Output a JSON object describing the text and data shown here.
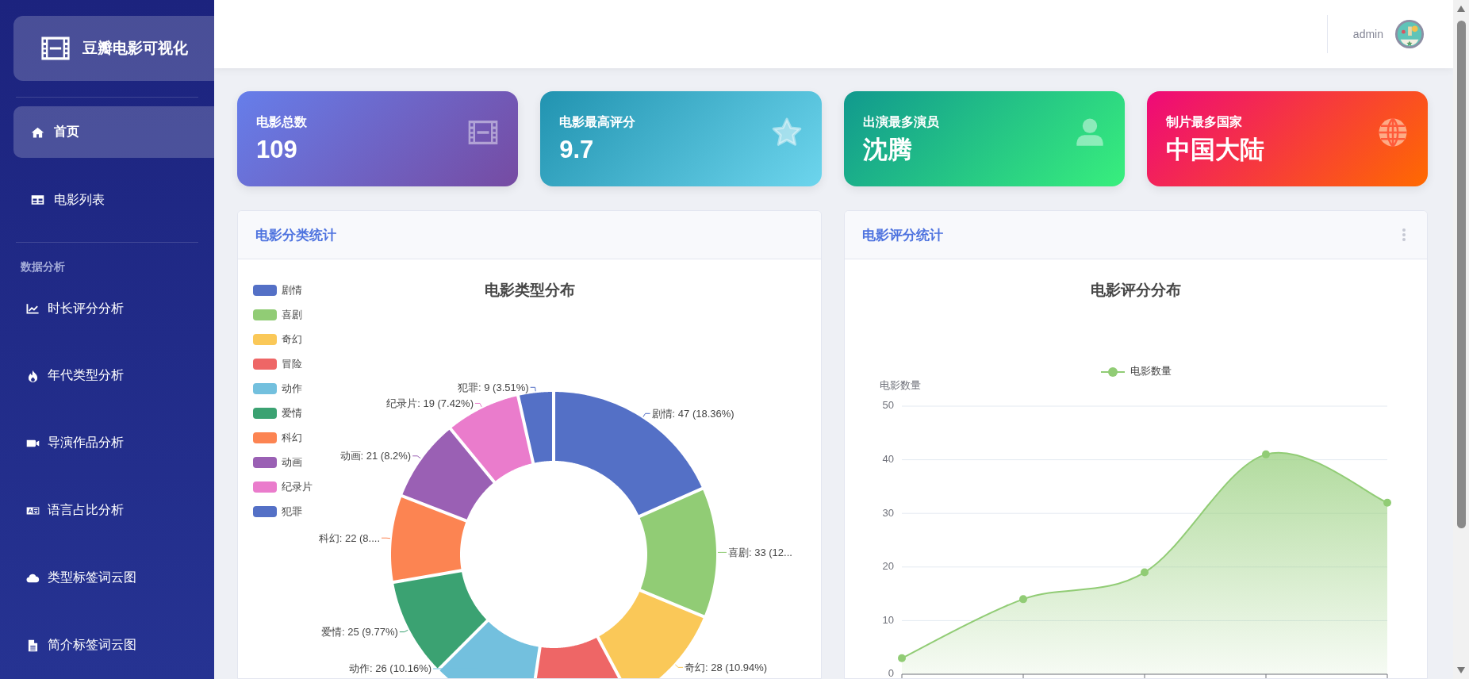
{
  "sidebar": {
    "brand": "豆瓣电影可视化",
    "items": [
      {
        "label": "首页",
        "selected": true
      },
      {
        "label": "电影列表",
        "selected": false
      }
    ],
    "section_title": "数据分析",
    "analysis_items": [
      {
        "label": "时长评分分析",
        "selected": false
      },
      {
        "label": "年代类型分析",
        "selected": false
      },
      {
        "label": "导演作品分析",
        "selected": false
      },
      {
        "label": "语言占比分析",
        "selected": false
      },
      {
        "label": "类型标签词云图",
        "selected": false
      },
      {
        "label": "简介标签词云图",
        "selected": false
      }
    ]
  },
  "header": {
    "user": "admin"
  },
  "stat_cards": [
    {
      "label": "电影总数",
      "value": "109"
    },
    {
      "label": "电影最高评分",
      "value": "9.7"
    },
    {
      "label": "出演最多演员",
      "value": "沈腾"
    },
    {
      "label": "制片最多国家",
      "value": "中国大陆"
    }
  ],
  "panels": [
    {
      "title": "电影分类统计",
      "has_menu": false,
      "chart_data": {
        "type": "donut",
        "title": "电影类型分布",
        "legend": "top-left",
        "categories": [
          "剧情",
          "喜剧",
          "奇幻",
          "冒险",
          "动作",
          "爱情",
          "科幻",
          "动画",
          "纪录片",
          "犯罪"
        ],
        "values": [
          47,
          33,
          28,
          26,
          26,
          25,
          22,
          21,
          19,
          9
        ],
        "colors": [
          "#5470c6",
          "#91cc75",
          "#fac858",
          "#ee6666",
          "#73c0de",
          "#3ba272",
          "#fc8452",
          "#9a60b4",
          "#ea7ccc",
          "#5470c6"
        ],
        "value_labels": [
          "剧情: 47 (18.36%)",
          "喜剧: 33 (12...",
          "奇幻: 28 (10.94%)",
          null,
          "动作: 26 (10.16%)",
          "爱情: 25 (9.77%)",
          "科幻: 22 (8....",
          "动画: 21 (8.2%)",
          "纪录片: 19 (7.42%)",
          "犯罪: 9 (3.51%)"
        ]
      }
    },
    {
      "title": "电影评分统计",
      "has_menu": true,
      "chart_data": {
        "type": "area",
        "title": "电影评分分布",
        "ylabel": "电影数量",
        "legend": "top",
        "grid": true,
        "series": [
          {
            "name": "电影数量",
            "color": "#91cc75",
            "values": [
              3,
              14,
              19,
              41,
              32
            ]
          }
        ],
        "ylim": [
          0,
          50
        ],
        "yticks": [
          0,
          10,
          20,
          30,
          40,
          50
        ]
      }
    }
  ]
}
